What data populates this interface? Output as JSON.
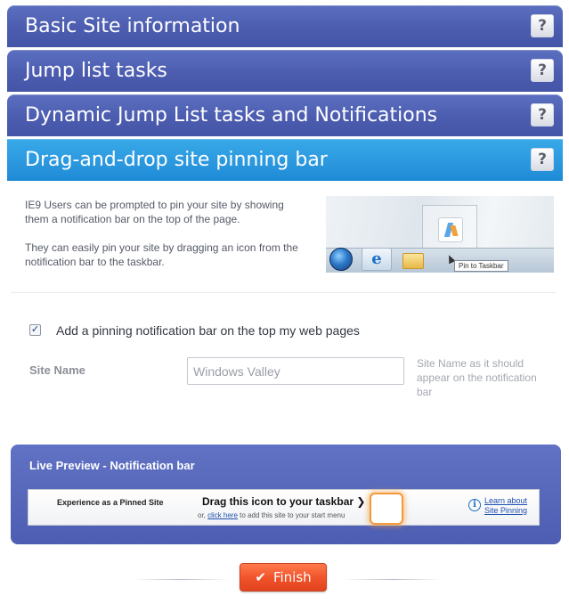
{
  "sections": [
    {
      "title": "Basic Site information",
      "help": "?"
    },
    {
      "title": "Jump list tasks",
      "help": "?"
    },
    {
      "title": "Dynamic Jump List tasks and Notifications",
      "help": "?"
    },
    {
      "title": "Drag-and-drop site pinning bar",
      "help": "?"
    }
  ],
  "panel": {
    "description_1": "IE9 Users can be prompted to pin your site by showing them a notification bar on the top of the page.",
    "description_2": "They can easily pin your site by dragging an icon from the notification bar to the taskbar.",
    "illustration": {
      "ie_glyph": "e",
      "tooltip": "Pin to Taskbar"
    },
    "checkbox": {
      "checked": true,
      "mark": "✓",
      "label": "Add a pinning notification bar on the top my web pages"
    },
    "site_name": {
      "label": "Site Name",
      "value": "Windows Valley",
      "hint": "Site Name as it should appear on the notification bar"
    },
    "preview": {
      "title": "Live Preview - Notification bar",
      "bar": {
        "left_text": "Experience as a Pinned Site",
        "drag_text": "Drag this icon to your taskbar",
        "drag_arrow": "❯",
        "sub_prefix": "or, ",
        "sub_link": "click here",
        "sub_suffix": " to add this site to your start menu",
        "info_glyph": "i",
        "learn_more": "Learn about Site Pinning"
      }
    },
    "finish": {
      "label": "Finish",
      "icon": "check-icon",
      "glyph": "✔"
    }
  },
  "colors": {
    "header_blue": "#4c5db0",
    "active_header": "#2a97de",
    "finish_orange": "#f0522a",
    "icon_glow": "#f39a3a"
  }
}
